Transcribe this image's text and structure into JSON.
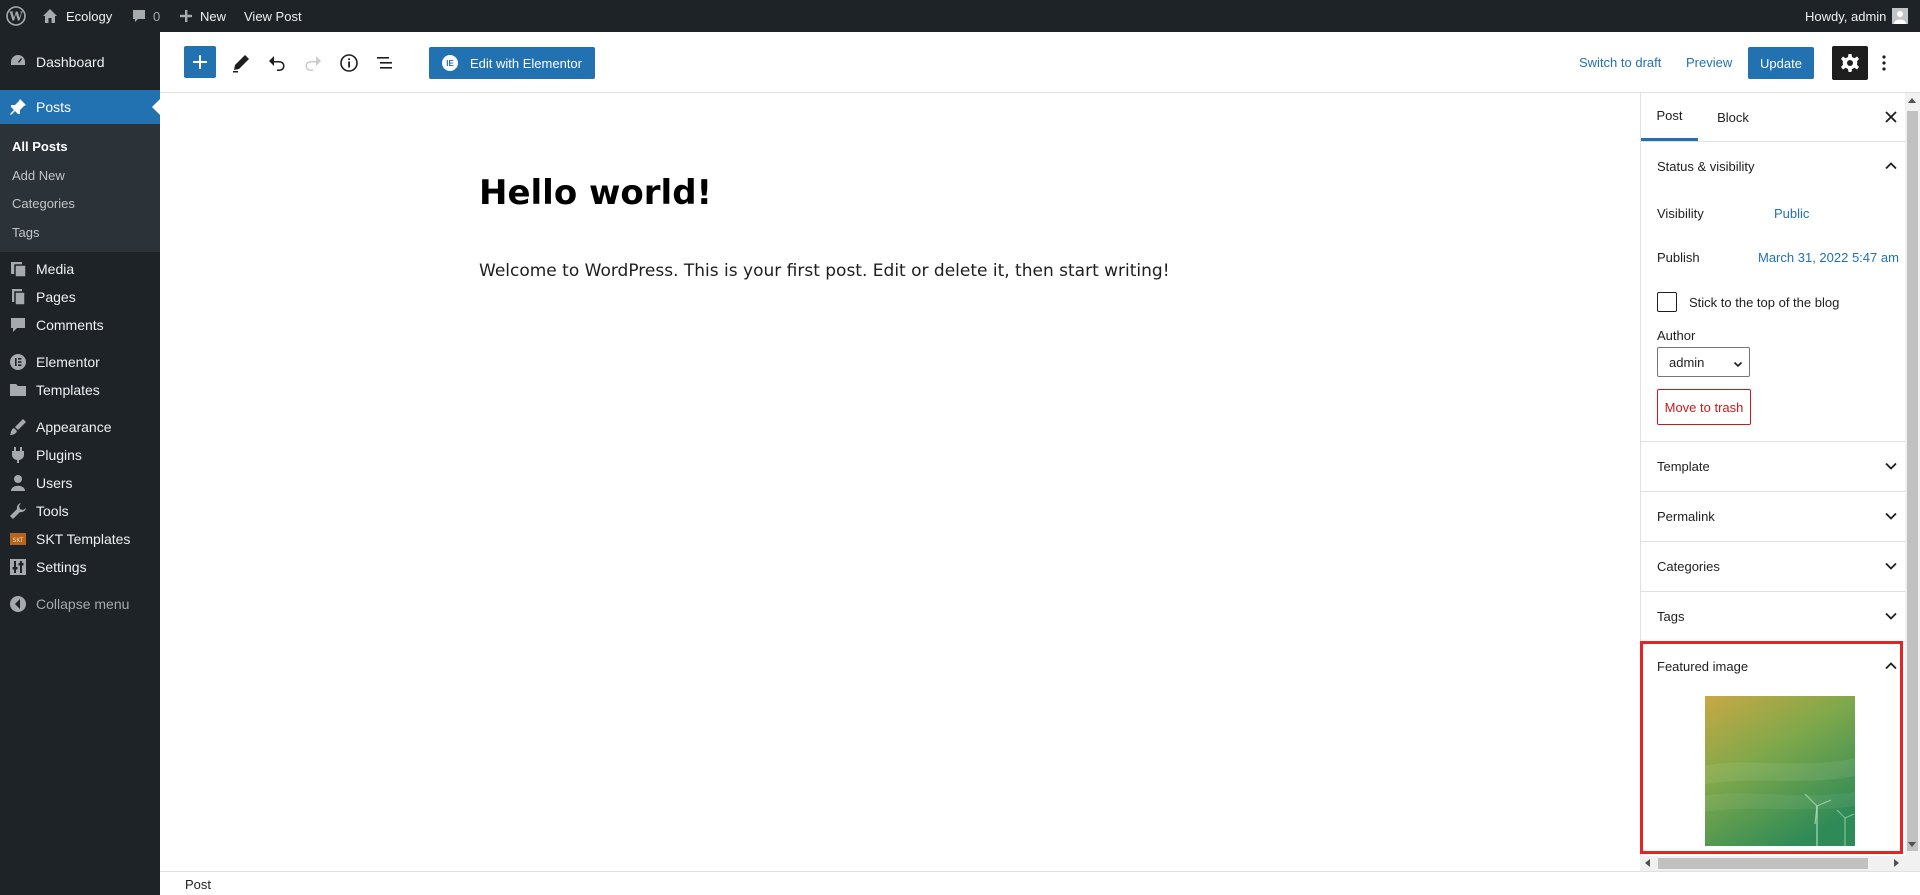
{
  "admin_bar": {
    "site_name": "Ecology",
    "comments_count": "0",
    "new_label": "New",
    "view_post_label": "View Post",
    "greeting": "Howdy, admin"
  },
  "sidebar": {
    "items": [
      {
        "label": "Dashboard",
        "icon": "dashboard-icon"
      },
      {
        "label": "Posts",
        "icon": "pushpin-icon"
      },
      {
        "label": "Media",
        "icon": "media-icon"
      },
      {
        "label": "Pages",
        "icon": "pages-icon"
      },
      {
        "label": "Comments",
        "icon": "comments-icon"
      },
      {
        "label": "Elementor",
        "icon": "elementor-icon"
      },
      {
        "label": "Templates",
        "icon": "folder-icon"
      },
      {
        "label": "Appearance",
        "icon": "brush-icon"
      },
      {
        "label": "Plugins",
        "icon": "plugin-icon"
      },
      {
        "label": "Users",
        "icon": "user-icon"
      },
      {
        "label": "Tools",
        "icon": "wrench-icon"
      },
      {
        "label": "SKT Templates",
        "icon": "skt-icon"
      },
      {
        "label": "Settings",
        "icon": "settings-sliders-icon"
      },
      {
        "label": "Collapse menu",
        "icon": "collapse-arrow-icon"
      }
    ],
    "submenu": [
      "All Posts",
      "Add New",
      "Categories",
      "Tags"
    ]
  },
  "toolbar": {
    "elementor_label": "Edit with Elementor",
    "switch_to_draft": "Switch to draft",
    "preview": "Preview",
    "update": "Update"
  },
  "post": {
    "title": "Hello world!",
    "content": "Welcome to WordPress. This is your first post. Edit or delete it, then start writing!"
  },
  "settings_panel": {
    "tabs": [
      "Post",
      "Block"
    ],
    "status_title": "Status & visibility",
    "visibility_label": "Visibility",
    "visibility_value": "Public",
    "publish_label": "Publish",
    "publish_value": "March 31, 2022 5:47 am",
    "sticky_label": "Stick to the top of the blog",
    "author_label": "Author",
    "author_value": "admin",
    "trash_label": "Move to trash",
    "sections": [
      "Template",
      "Permalink",
      "Categories",
      "Tags"
    ],
    "featured_title": "Featured image"
  },
  "footer": {
    "breadcrumb": "Post"
  },
  "colors": {
    "accent": "#2271b1",
    "admin_dark": "#1d2327",
    "danger": "#cc1818",
    "highlight": "#e62222"
  }
}
